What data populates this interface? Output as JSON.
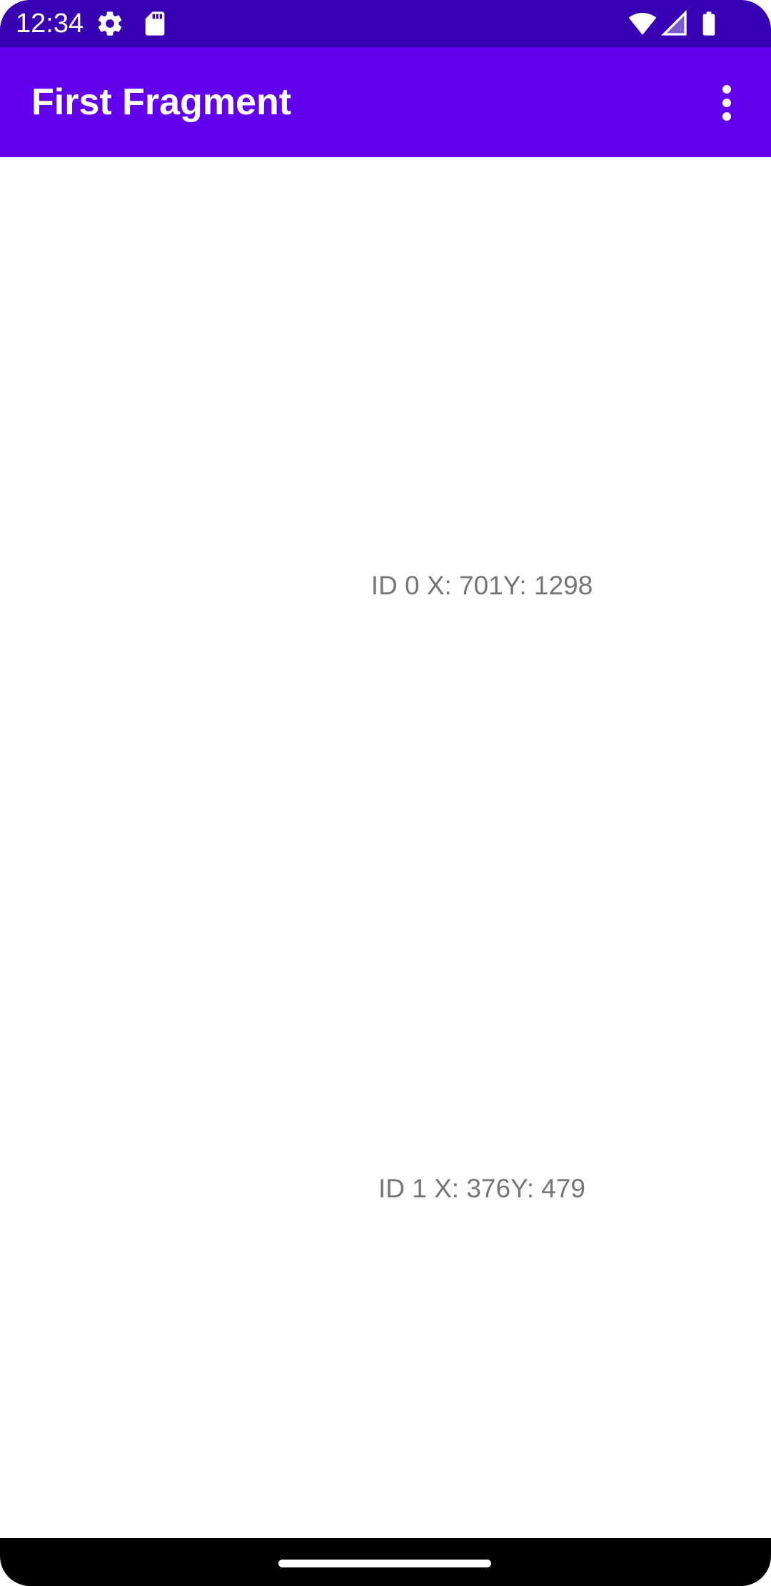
{
  "status_bar": {
    "time": "12:34",
    "icons": [
      "settings-gear-icon",
      "sd-card-icon",
      "wifi-icon",
      "cellular-signal-icon",
      "battery-icon"
    ]
  },
  "app_bar": {
    "title": "First Fragment",
    "overflow_icon": "more-vert-icon"
  },
  "touches": [
    {
      "text": "ID 0 X: 701Y: 1298"
    },
    {
      "text": "ID 1 X: 376Y: 479"
    }
  ],
  "colors": {
    "status_bar": "#3700b3",
    "app_bar": "#6200ee",
    "label_text": "#767676"
  }
}
